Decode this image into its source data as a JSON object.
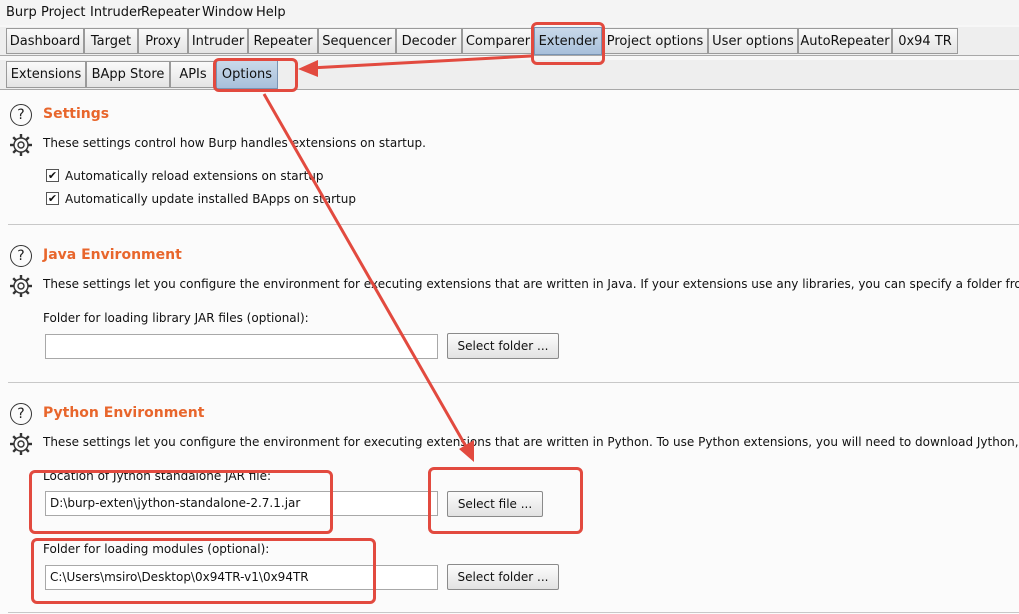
{
  "menubar": [
    "Burp",
    "Project",
    "Intruder",
    "Repeater",
    "Window",
    "Help"
  ],
  "main_tabs": [
    "Dashboard",
    "Target",
    "Proxy",
    "Intruder",
    "Repeater",
    "Sequencer",
    "Decoder",
    "Comparer",
    "Extender",
    "Project options",
    "User options",
    "AutoRepeater",
    "0x94 TR"
  ],
  "sub_tabs": [
    "Extensions",
    "BApp Store",
    "APIs",
    "Options"
  ],
  "settings": {
    "title": "Settings",
    "description": "These settings control how Burp handles extensions on startup.",
    "options": [
      {
        "label": "Automatically reload extensions on startup",
        "checked": true
      },
      {
        "label": "Automatically update installed BApps on startup",
        "checked": true
      }
    ]
  },
  "java": {
    "title": "Java Environment",
    "description": "These settings let you configure the environment for executing extensions that are written in Java. If your extensions use any libraries, you can specify a folder from which",
    "folder_label": "Folder for loading library JAR files (optional):",
    "folder_value": "",
    "select_folder_label": "Select folder ..."
  },
  "python": {
    "title": "Python Environment",
    "description": "These settings let you configure the environment for executing extensions that are written in Python. To use Python extensions, you will need to download Jython, which i",
    "jar_label": "Location of Jython standalone JAR file:",
    "jar_value": "D:\\burp-exten\\jython-standalone-2.7.1.jar",
    "select_file_label": "Select file ...",
    "modules_label": "Folder for loading modules (optional):",
    "modules_value": "C:\\Users\\msiro\\Desktop\\0x94TR-v1\\0x94TR",
    "select_folder_label": "Select folder ..."
  },
  "colors": {
    "accent_title": "#e8662c",
    "annotation_red": "#e24a3f",
    "active_tab": "#b3c8e0"
  }
}
